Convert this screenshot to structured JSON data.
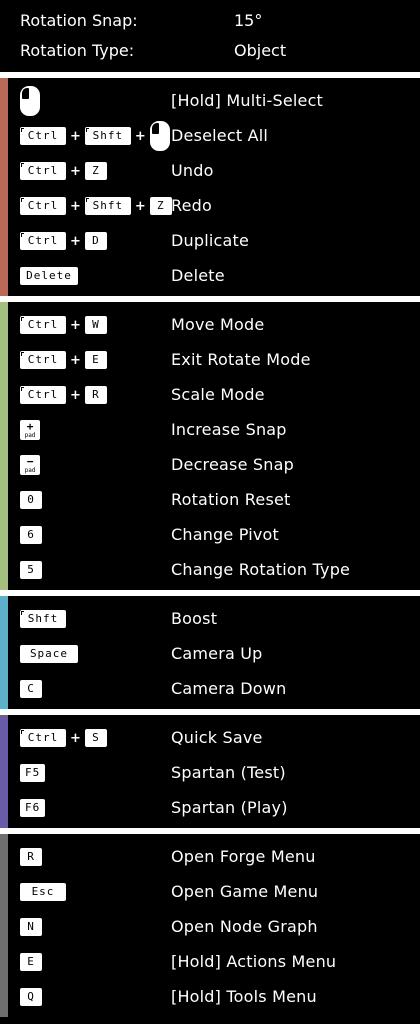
{
  "settings": [
    {
      "label": "Rotation Snap:",
      "value": "15°"
    },
    {
      "label": "Rotation Type:",
      "value": "Object"
    }
  ],
  "colors": {
    "editing": "#b86a56",
    "transform": "#a3c07e",
    "camera": "#5eb0c9",
    "save_play": "#6a5ba6",
    "menus": "#6f6f6f"
  },
  "sections": [
    {
      "id": "editing",
      "rows": [
        {
          "keys": [
            {
              "type": "mouse",
              "icon": "mouse-left-click-icon"
            }
          ],
          "action": "[Hold] Multi-Select"
        },
        {
          "keys": [
            {
              "type": "key",
              "label": "Ctrl",
              "tick": true
            },
            {
              "type": "key",
              "label": "Shft",
              "tick": true
            },
            {
              "type": "mouse",
              "icon": "mouse-left-click-icon"
            }
          ],
          "action": "Deselect All"
        },
        {
          "keys": [
            {
              "type": "key",
              "label": "Ctrl",
              "tick": true
            },
            {
              "type": "key",
              "label": "Z"
            }
          ],
          "action": "Undo"
        },
        {
          "keys": [
            {
              "type": "key",
              "label": "Ctrl",
              "tick": true
            },
            {
              "type": "key",
              "label": "Shft",
              "tick": true
            },
            {
              "type": "key",
              "label": "Z"
            }
          ],
          "action": "Redo"
        },
        {
          "keys": [
            {
              "type": "key",
              "label": "Ctrl",
              "tick": true
            },
            {
              "type": "key",
              "label": "D"
            }
          ],
          "action": "Duplicate"
        },
        {
          "keys": [
            {
              "type": "key",
              "label": "Delete"
            }
          ],
          "action": "Delete"
        }
      ]
    },
    {
      "id": "transform",
      "rows": [
        {
          "keys": [
            {
              "type": "key",
              "label": "Ctrl",
              "tick": true
            },
            {
              "type": "key",
              "label": "W"
            }
          ],
          "action": "Move Mode"
        },
        {
          "keys": [
            {
              "type": "key",
              "label": "Ctrl",
              "tick": true
            },
            {
              "type": "key",
              "label": "E"
            }
          ],
          "action": "Exit Rotate Mode"
        },
        {
          "keys": [
            {
              "type": "key",
              "label": "Ctrl",
              "tick": true
            },
            {
              "type": "key",
              "label": "R"
            }
          ],
          "action": "Scale Mode"
        },
        {
          "keys": [
            {
              "type": "numpad",
              "symbol": "+",
              "sub": "pad"
            }
          ],
          "action": "Increase Snap"
        },
        {
          "keys": [
            {
              "type": "numpad",
              "symbol": "−",
              "sub": "pad"
            }
          ],
          "action": "Decrease Snap"
        },
        {
          "keys": [
            {
              "type": "key",
              "label": "0"
            }
          ],
          "action": "Rotation Reset"
        },
        {
          "keys": [
            {
              "type": "key",
              "label": "6"
            }
          ],
          "action": "Change Pivot"
        },
        {
          "keys": [
            {
              "type": "key",
              "label": "5"
            }
          ],
          "action": "Change Rotation Type"
        }
      ]
    },
    {
      "id": "camera",
      "rows": [
        {
          "keys": [
            {
              "type": "key",
              "label": "Shft",
              "tick": true
            }
          ],
          "action": "Boost"
        },
        {
          "keys": [
            {
              "type": "key",
              "label": "Space"
            }
          ],
          "action": "Camera Up"
        },
        {
          "keys": [
            {
              "type": "key",
              "label": "C"
            }
          ],
          "action": "Camera Down"
        }
      ]
    },
    {
      "id": "save_play",
      "rows": [
        {
          "keys": [
            {
              "type": "key",
              "label": "Ctrl",
              "tick": true
            },
            {
              "type": "key",
              "label": "S"
            }
          ],
          "action": "Quick Save"
        },
        {
          "keys": [
            {
              "type": "key",
              "label": "F5"
            }
          ],
          "action": "Spartan (Test)"
        },
        {
          "keys": [
            {
              "type": "key",
              "label": "F6"
            }
          ],
          "action": "Spartan (Play)"
        }
      ]
    },
    {
      "id": "menus",
      "rows": [
        {
          "keys": [
            {
              "type": "key",
              "label": "R"
            }
          ],
          "action": "Open Forge Menu"
        },
        {
          "keys": [
            {
              "type": "key",
              "label": "Esc"
            }
          ],
          "action": "Open Game Menu"
        },
        {
          "keys": [
            {
              "type": "key",
              "label": "N"
            }
          ],
          "action": "Open Node Graph"
        },
        {
          "keys": [
            {
              "type": "key",
              "label": "E"
            }
          ],
          "action": "[Hold] Actions Menu"
        },
        {
          "keys": [
            {
              "type": "key",
              "label": "Q"
            }
          ],
          "action": "[Hold] Tools Menu"
        }
      ]
    }
  ]
}
